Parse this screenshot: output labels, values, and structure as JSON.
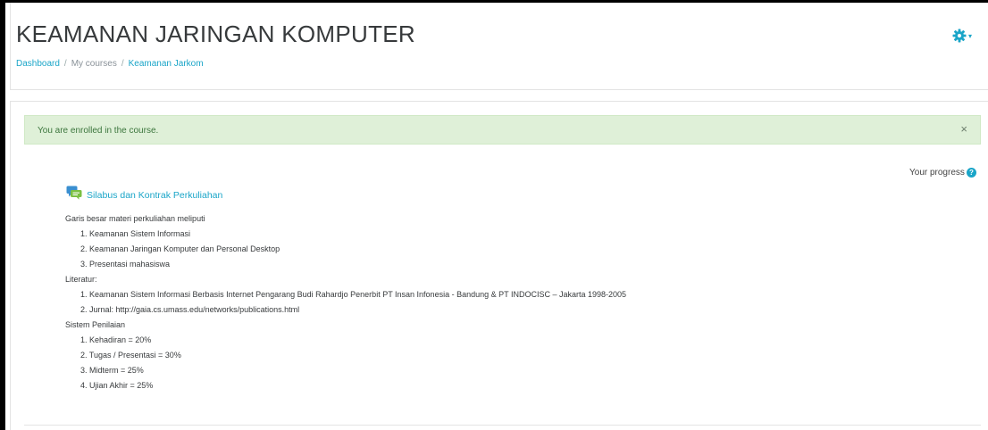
{
  "header": {
    "title": "KEAMANAN JARINGAN KOMPUTER",
    "breadcrumb": [
      {
        "label": "Dashboard",
        "link": true
      },
      {
        "label": "My courses",
        "link": false
      },
      {
        "label": "Keamanan Jarkom",
        "link": true
      }
    ],
    "settings_icon": "gear-icon",
    "caret": "▾"
  },
  "alert": {
    "message": "You are enrolled in the course.",
    "close": "×"
  },
  "progress": {
    "label": "Your progress",
    "help_glyph": "?"
  },
  "activity": {
    "icon": "forum-icon",
    "label": "Silabus dan Kontrak Perkuliahan"
  },
  "summary": {
    "intro": "Garis besar materi perkuliahan meliputi",
    "topics": [
      "1. Keamanan Sistem Informasi",
      "2. Keamanan Jaringan Komputer dan Personal Desktop",
      "3. Presentasi mahasiswa"
    ],
    "literature_heading": "Literatur:",
    "literature": [
      "1. Keamanan Sistem Informasi Berbasis Internet Pengarang Budi Rahardjo Penerbit PT Insan Infonesia - Bandung & PT INDOCISC – Jakarta 1998-2005",
      "2. Jurnal: http://gaia.cs.umass.edu/networks/publications.html"
    ],
    "grading_heading": "Sistem Penilaian",
    "grading": [
      "1. Kehadiran = 20%",
      "2. Tugas / Presentasi = 30%",
      "3. Midterm = 25%",
      "4. Ujian Akhir = 25%"
    ]
  },
  "colors": {
    "accent": "#1aa5c8",
    "alert_bg": "#dff0d8",
    "alert_text": "#3c763d"
  }
}
